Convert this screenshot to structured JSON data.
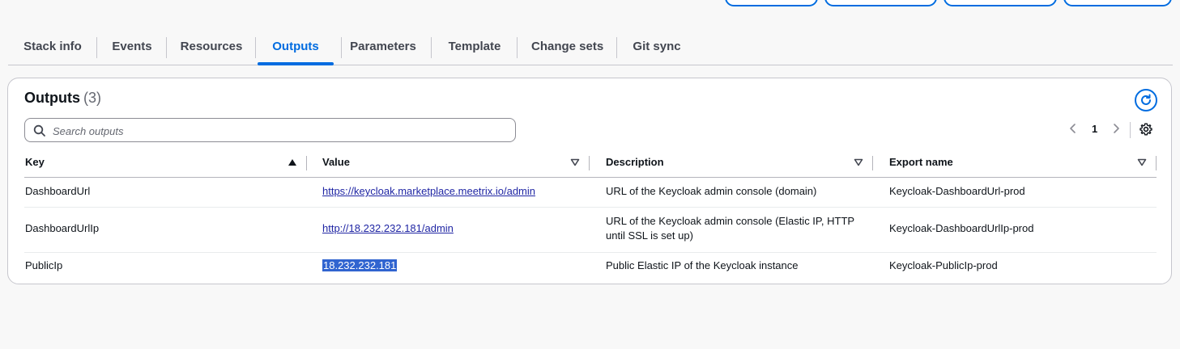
{
  "tabs": [
    {
      "label": "Stack info"
    },
    {
      "label": "Events"
    },
    {
      "label": "Resources"
    },
    {
      "label": "Outputs",
      "active": true
    },
    {
      "label": "Parameters"
    },
    {
      "label": "Template"
    },
    {
      "label": "Change sets"
    },
    {
      "label": "Git sync"
    }
  ],
  "panel": {
    "title": "Outputs",
    "count": "(3)"
  },
  "search": {
    "placeholder": "Search outputs",
    "value": ""
  },
  "pagination": {
    "current_page": "1"
  },
  "table": {
    "columns": [
      "Key",
      "Value",
      "Description",
      "Export name"
    ],
    "rows": [
      {
        "key": "DashboardUrl",
        "value": "https://keycloak.marketplace.meetrix.io/admin",
        "description_line1": "URL of the Keycloak admin console (domain)",
        "description_line2": "",
        "export_name": "Keycloak-DashboardUrl-prod"
      },
      {
        "key": "DashboardUrlIp",
        "value": "http://18.232.232.181/admin",
        "description_line1": "URL of the Keycloak admin console (Elastic IP, HTTP",
        "description_line2": "until SSL is set up)",
        "export_name": "Keycloak-DashboardUrlIp-prod"
      },
      {
        "key": "PublicIp",
        "value": "18.232.232.181",
        "description_line1": "Public Elastic IP of the Keycloak instance",
        "description_line2": "",
        "export_name": "Keycloak-PublicIp-prod"
      }
    ]
  },
  "colors": {
    "accent": "#006ce0",
    "selection": "#3064d0"
  }
}
